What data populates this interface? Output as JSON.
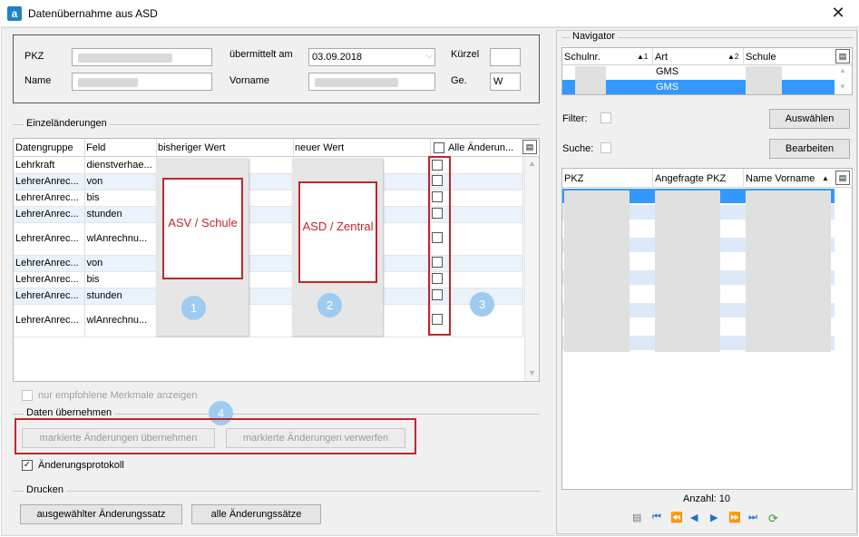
{
  "window": {
    "title": "Datenübernahme aus ASD",
    "close_glyph": "✕"
  },
  "header": {
    "pkz_label": "PKZ",
    "name_label": "Name",
    "uebermittelt_label": "übermittelt am",
    "uebermittelt_value": "03.09.2018",
    "vorname_label": "Vorname",
    "kuerzel_label": "Kürzel",
    "ge_label": "Ge.",
    "ge_value": "W"
  },
  "einzel": {
    "group_title": "Einzeländerungen",
    "columns": [
      "Datengruppe",
      "Feld",
      "bisheriger Wert",
      "neuer Wert",
      "Alle Änderun..."
    ],
    "rows": [
      {
        "gruppe": "Lehrkraft",
        "feld": "dienstverhae..."
      },
      {
        "gruppe": "LehrerAnrec...",
        "feld": "von"
      },
      {
        "gruppe": "LehrerAnrec...",
        "feld": "bis"
      },
      {
        "gruppe": "LehrerAnrec...",
        "feld": "stunden"
      },
      {
        "gruppe": "LehrerAnrec...",
        "feld": "wlAnrechnu..."
      },
      {
        "gruppe": "LehrerAnrec...",
        "feld": "von"
      },
      {
        "gruppe": "LehrerAnrec...",
        "feld": "bis"
      },
      {
        "gruppe": "LehrerAnrec...",
        "feld": "stunden"
      },
      {
        "gruppe": "LehrerAnrec...",
        "feld": "wlAnrechnu..."
      }
    ],
    "annotation_asv": "ASV / Schule",
    "annotation_asd": "ASD / Zentral",
    "marker_1": "1",
    "marker_2": "2",
    "marker_3": "3",
    "nur_empfohlene": "nur empfohlene Merkmale anzeigen"
  },
  "uebernehmen": {
    "group_title": "Daten übernehmen",
    "marker_4": "4",
    "btn_uebernehmen": "markierte Änderungen übernehmen",
    "btn_verwerfen": "markierte Änderungen verwerfen",
    "protokoll_label": "Änderungsprotokoll"
  },
  "drucken": {
    "group_title": "Drucken",
    "btn_ausgewaehlt": "ausgewählter Änderungssatz",
    "btn_alle": "alle Änderungssätze"
  },
  "navigator": {
    "group_title": "Navigator",
    "columns": [
      "Schulnr.",
      "Art",
      "Schule"
    ],
    "sort1": "▲1",
    "sort2": "▲2",
    "row1_art": "GMS",
    "row2_art": "GMS",
    "filter_label": "Filter:",
    "suche_label": "Suche:",
    "btn_auswaehlen": "Auswählen",
    "btn_bearbeiten": "Bearbeiten",
    "list_columns": [
      "PKZ",
      "Angefragte PKZ",
      "Name Vorname"
    ],
    "anzahl": "Anzahl: 10"
  },
  "colors": {
    "accent": "#1c84c6",
    "annotation_red": "#c0262b",
    "selection": "#3399ff",
    "marker": "#9ecbf0"
  }
}
